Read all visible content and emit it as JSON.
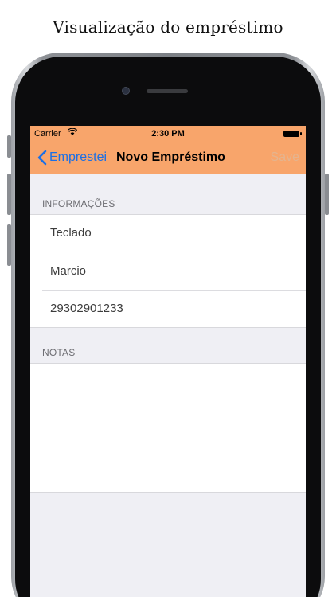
{
  "caption": "Visualização do empréstimo",
  "status_bar": {
    "carrier": "Carrier",
    "time": "2:30 PM"
  },
  "nav": {
    "back_label": "Emprestei",
    "title": "Novo Empréstimo",
    "save_label": "Save",
    "bar_color": "#f8a56b",
    "tint_color": "#1a6fe6"
  },
  "form": {
    "info_header": "INFORMAÇÕES",
    "fields": [
      {
        "value": "Teclado"
      },
      {
        "value": "Marcio"
      },
      {
        "value": "29302901233"
      }
    ],
    "notes_header": "NOTAS",
    "notes_value": ""
  },
  "icons": {
    "wifi": "wifi-icon",
    "battery": "battery-icon",
    "back": "chevron-left-icon"
  }
}
